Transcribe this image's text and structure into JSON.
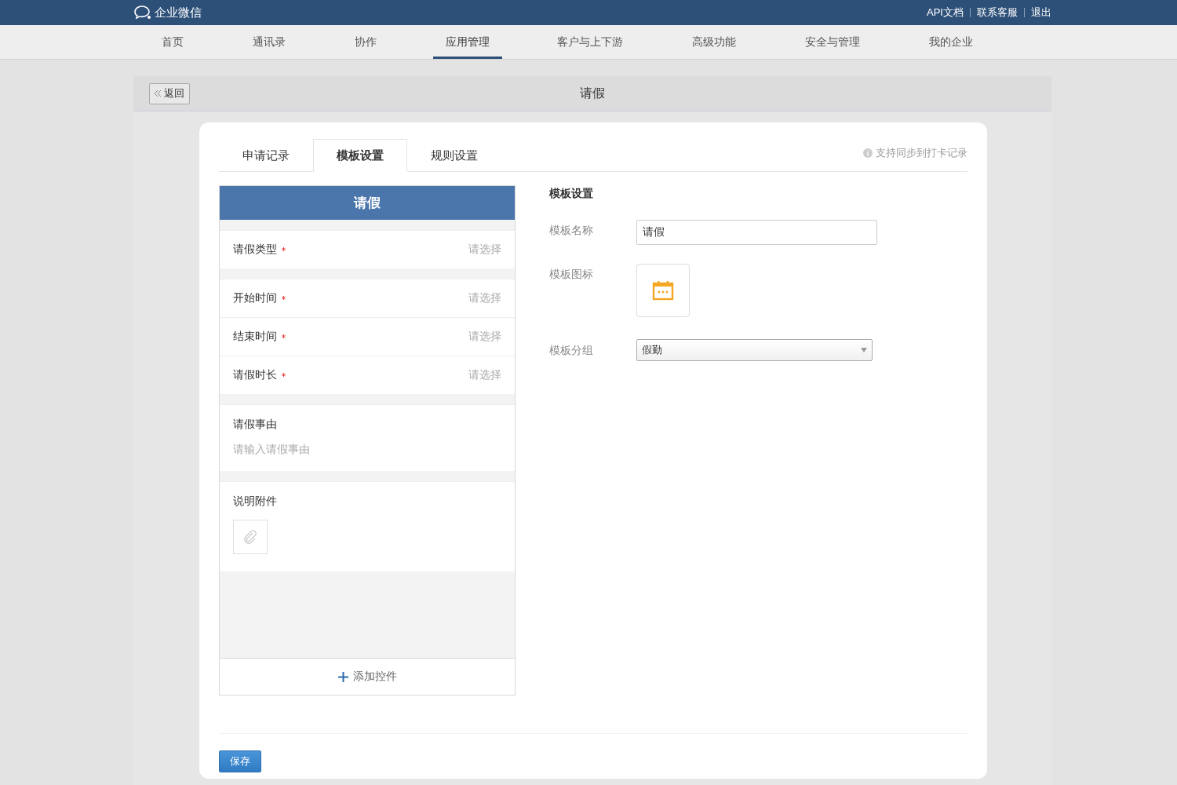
{
  "topbar": {
    "logo": "企业微信",
    "links": [
      "API文档",
      "联系客服",
      "退出"
    ]
  },
  "nav": [
    {
      "label": "首页",
      "selected": false
    },
    {
      "label": "通讯录",
      "selected": false
    },
    {
      "label": "协作",
      "selected": false
    },
    {
      "label": "应用管理",
      "selected": true
    },
    {
      "label": "客户与上下游",
      "selected": false
    },
    {
      "label": "高级功能",
      "selected": false
    },
    {
      "label": "安全与管理",
      "selected": false
    },
    {
      "label": "我的企业",
      "selected": false
    }
  ],
  "panel": {
    "back": "返回",
    "title": "请假"
  },
  "tabs": [
    {
      "label": "申请记录",
      "selected": false
    },
    {
      "label": "模板设置",
      "selected": true
    },
    {
      "label": "规则设置",
      "selected": false
    }
  ],
  "note": "支持同步到打卡记录",
  "preview": {
    "title": "请假",
    "groups": [
      {
        "fields": [
          {
            "kind": "select",
            "label": "请假类型",
            "required": true,
            "hint": "请选择"
          }
        ]
      },
      {
        "fields": [
          {
            "kind": "select",
            "label": "开始时间",
            "required": true,
            "hint": "请选择"
          },
          {
            "kind": "select",
            "label": "结束时间",
            "required": true,
            "hint": "请选择"
          },
          {
            "kind": "select",
            "label": "请假时长",
            "required": true,
            "hint": "请选择"
          }
        ]
      },
      {
        "fields": [
          {
            "kind": "textarea",
            "label": "请假事由",
            "hint": "请输入请假事由"
          }
        ]
      },
      {
        "fields": [
          {
            "kind": "attachment",
            "label": "说明附件"
          }
        ]
      }
    ],
    "add": "添加控件"
  },
  "settings": {
    "heading": "模板设置",
    "name_label": "模板名称",
    "name_value": "请假",
    "icon_label": "模板图标",
    "group_label": "模板分组",
    "group_value": "假勤"
  },
  "save": "保存"
}
